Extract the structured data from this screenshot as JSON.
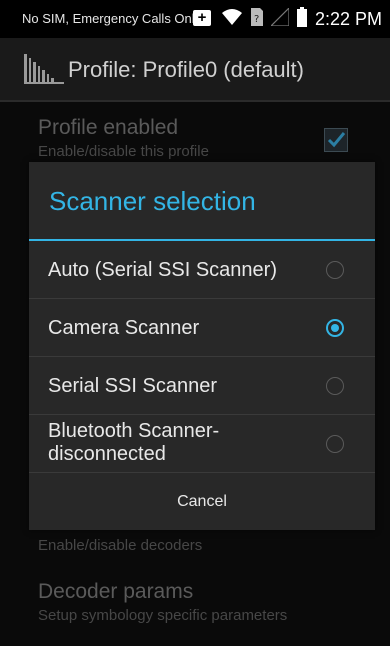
{
  "status_bar": {
    "carrier_text": "No SIM, Emergency Calls Only",
    "time": "2:22 PM"
  },
  "action_bar": {
    "title": "Profile: Profile0 (default)"
  },
  "prefs": {
    "profile_enabled": {
      "title": "Profile enabled",
      "summary": "Enable/disable this profile",
      "checked": true
    },
    "decoders": {
      "summary": "Enable/disable decoders"
    },
    "decoder_params": {
      "title": "Decoder params",
      "summary": "Setup symbology specific parameters"
    }
  },
  "dialog": {
    "title": "Scanner selection",
    "options": [
      {
        "label": "Auto (Serial SSI Scanner)",
        "checked": false
      },
      {
        "label": "Camera Scanner",
        "checked": true
      },
      {
        "label": "Serial SSI Scanner",
        "checked": false
      },
      {
        "label": "Bluetooth Scanner-\ndisconnected",
        "checked": false
      }
    ],
    "cancel_label": "Cancel"
  },
  "colors": {
    "accent": "#33b5e5",
    "dialog_bg": "#282828",
    "background": "#0a0a0a"
  }
}
